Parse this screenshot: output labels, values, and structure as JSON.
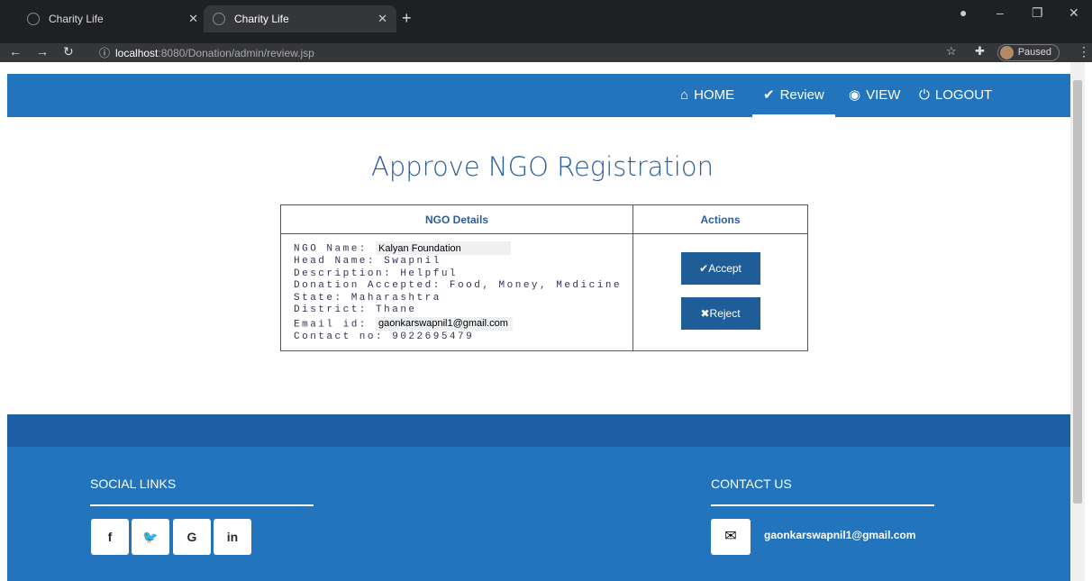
{
  "browser": {
    "tabs": [
      {
        "title": "Charity Life"
      },
      {
        "title": "Charity Life"
      }
    ],
    "url_host": "localhost",
    "url_path": ":8080/Donation/admin/review.jsp",
    "profile_label": "Paused"
  },
  "nav": {
    "items": [
      {
        "icon": "home-icon",
        "label": "HOME"
      },
      {
        "icon": "check-icon",
        "label": "Review"
      },
      {
        "icon": "eye-icon",
        "label": "VIEW"
      },
      {
        "icon": "power-icon",
        "label": "LOGOUT"
      }
    ],
    "active": "Review"
  },
  "main": {
    "title": "Approve NGO Registration",
    "table": {
      "headers": [
        "NGO Details",
        "Actions"
      ],
      "ngo_name_label": "NGO Name:",
      "ngo_name_value": "Kalyan Foundation",
      "head_name": "Head Name: Swapnil",
      "description": "Description: Helpful",
      "donation": "Donation Accepted: Food, Money, Medicine",
      "state": "State: Maharashtra",
      "district": "District: Thane",
      "email_label": "Email id:",
      "email_value": "gaonkarswapnil1@gmail.com",
      "contact": "Contact no: 9022695479",
      "accept_label": "✔Accept",
      "reject_label": "✖Reject"
    }
  },
  "footer": {
    "social_heading": "SOCIAL LINKS",
    "social": [
      "f",
      "⚔",
      "G",
      "in"
    ],
    "contact_heading": "CONTACT US",
    "contact_email": "gaonkarswapnil1@gmail.com"
  },
  "colors": {
    "nav": "#2274bd",
    "footer_band": "#1c60a3",
    "heading": "#2a5d9b",
    "button": "#1f5d99"
  }
}
